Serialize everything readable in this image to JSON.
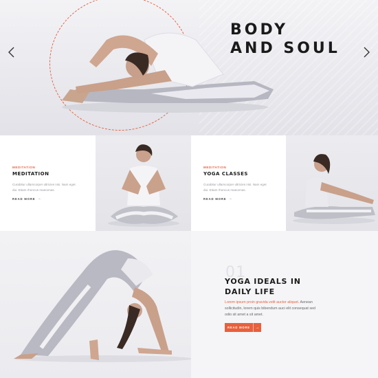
{
  "hero": {
    "title_line1": "BODY",
    "title_line2": "AND SOUL",
    "prev_icon": "chevron-left-icon",
    "next_icon": "chevron-right-icon"
  },
  "features": [
    {
      "kicker": "MEDITATION",
      "title": "MEDITATION",
      "text": "Curabitur ullamcorper ultricies nisi. Nam eget dui. Etiam rhoncus maecenas.",
      "link": "READ MORE"
    },
    {
      "kicker": "MEDITATION",
      "title": "YOGA CLASSES",
      "text": "Curabitur ullamcorper ultricies nisi. Nam eget dui. Etiam rhoncus maecenas.",
      "link": "READ MORE"
    }
  ],
  "ideals": {
    "number": "01",
    "title_line1": "YOGA IDEALS IN",
    "title_line2": "DAILY LIFE",
    "text_accent": "Lorem ipsum proin gravida velit auctor aliquet.",
    "text_rest": "Aenean sollicitudin, lorem quis bibendum auci elit consequat sed odio sit amet a sit amet.",
    "button": "READ MORE"
  },
  "colors": {
    "accent": "#e8603c",
    "text_dark": "#1a1a1a",
    "muted": "#9a9aa0",
    "panel_bg": "#f5f5f7"
  }
}
